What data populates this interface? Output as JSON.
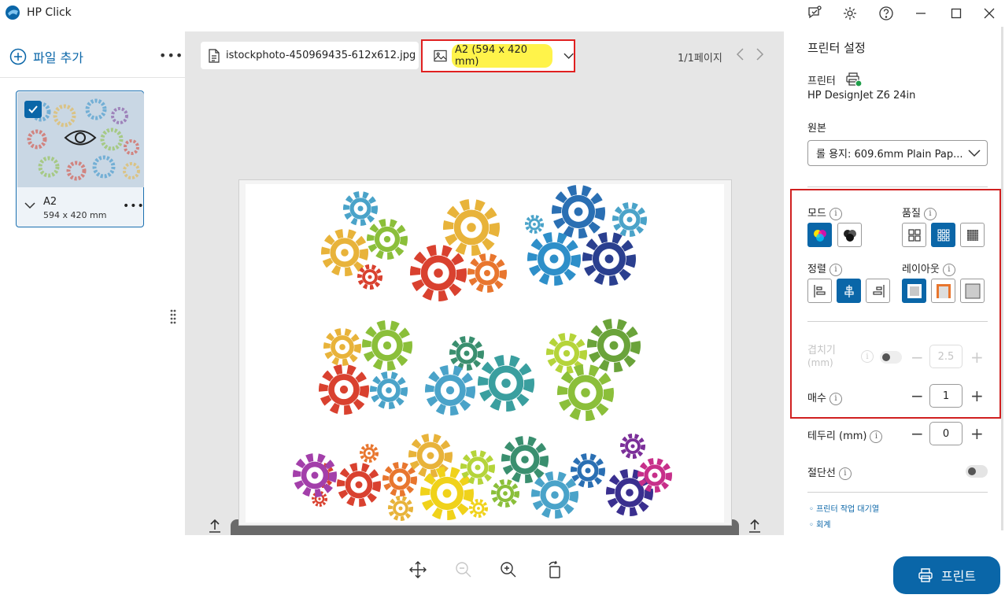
{
  "window": {
    "title": "HP Click"
  },
  "left_panel": {
    "add_file_label": "파일 추가",
    "more_label": "•••",
    "thumbnail": {
      "size_label": "A2",
      "size_dims": "594 x 420 mm",
      "more_label": "•••"
    }
  },
  "center": {
    "file_name": "istockphoto-450969435-612x612.jpg",
    "paper_size": "A2 (594 x 420 mm)",
    "page_indicator": "1/1페이지"
  },
  "print_button_label": "프린트",
  "settings": {
    "title": "프린터 설정",
    "printer_label": "프린터",
    "printer_name": "HP DesignJet Z6 24in",
    "source_label": "원본",
    "source_value": "롤 용지: 609.6mm Plain Pap...",
    "mode_label": "모드",
    "quality_label": "품질",
    "align_label": "정렬",
    "layout_label": "레이아웃",
    "overlap_label_1": "겹치기",
    "overlap_label_2": "(mm)",
    "overlap_value": "2.5",
    "copies_label": "매수",
    "copies_value": "1",
    "border_label": "테두리 (mm)",
    "border_value": "0",
    "cutline_label": "절단선",
    "links": [
      "프린터 작업 대기열",
      "회계"
    ]
  },
  "colors": {
    "accent": "#0a66a8",
    "highlight": "#fff34a",
    "annotation": "#e02020"
  }
}
